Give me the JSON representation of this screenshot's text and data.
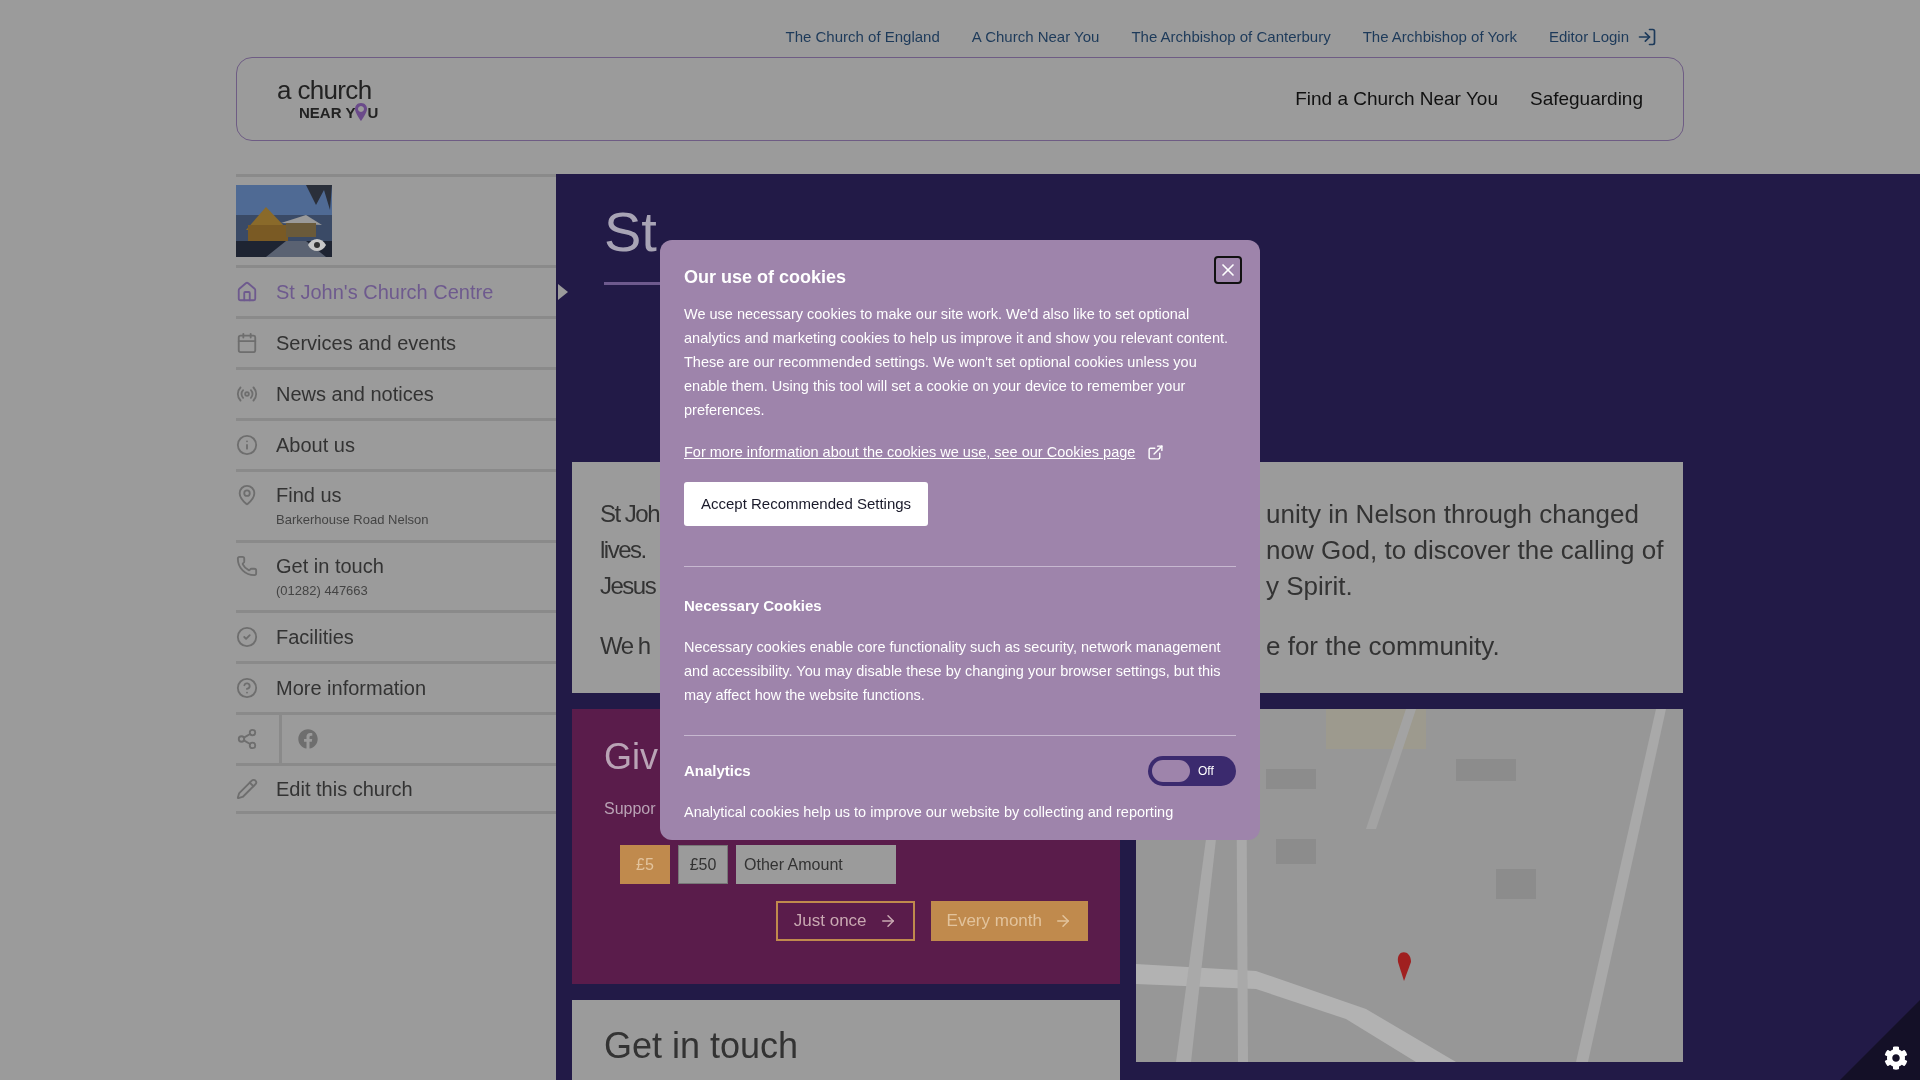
{
  "top_links": [
    {
      "label": "The Church of England"
    },
    {
      "label": "A Church Near You"
    },
    {
      "label": "The Archbishop of Canterbury"
    },
    {
      "label": "The Archbishop of York"
    },
    {
      "label": "Editor Login"
    }
  ],
  "logo": {
    "top": "a church",
    "bottom_left": "NEAR Y",
    "bottom_right": "U"
  },
  "header_nav": [
    "Find a Church Near You",
    "Safeguarding"
  ],
  "sidebar": {
    "items": [
      {
        "kind": "link",
        "label": "St John's Church Centre",
        "selected": true
      },
      {
        "kind": "link",
        "label": "Services and events",
        "selected": false
      },
      {
        "kind": "link",
        "label": "News and notices",
        "selected": false
      },
      {
        "kind": "link",
        "label": "About us",
        "selected": false
      },
      {
        "kind": "link",
        "label": "Find us",
        "sub": "Barkerhouse Road Nelson",
        "selected": false
      },
      {
        "kind": "link",
        "label": "Get in touch",
        "sub": "(01282) 447663",
        "selected": false
      },
      {
        "kind": "link",
        "label": "Facilities",
        "selected": false
      },
      {
        "kind": "link",
        "label": "More information",
        "selected": false
      },
      {
        "kind": "share"
      },
      {
        "kind": "link",
        "label": "Edit this church",
        "selected": false
      }
    ]
  },
  "hero": {
    "title": "St"
  },
  "intro": {
    "left": [
      "St Joh",
      "lives.",
      "Jesus"
    ],
    "right": [
      "unity in Nelson through changed",
      "now God, to discover the calling of",
      "y Spirit."
    ],
    "left2": "We h",
    "right2": "e for the community."
  },
  "give": {
    "title": "Giv",
    "subtitle": "Suppor",
    "amounts": [
      {
        "label": "£5",
        "selected": true
      },
      {
        "label": "£50",
        "selected": false
      }
    ],
    "other_placeholder": "Other Amount",
    "buttons": [
      {
        "label": "Just once",
        "kind": "outline"
      },
      {
        "label": "Every month",
        "kind": "filled"
      }
    ]
  },
  "contact": {
    "title": "Get in touch"
  },
  "cookies": {
    "title": "Our use of cookies",
    "body": "We use necessary cookies to make our site work. We'd also like to set optional analytics and marketing cookies to help us improve it and show you relevant content. These are our recommended settings. We won't set optional cookies unless you enable them. Using this tool will set a cookie on your device to remember your preferences.",
    "link": "For more information about the cookies we use, see our Cookies page",
    "accept": "Accept Recommended Settings",
    "sections": [
      {
        "title": "Necessary Cookies",
        "text": "Necessary cookies enable core functionality such as security, network management and accessibility. You may disable these by changing your browser settings, but this may affect how the website functions."
      },
      {
        "title": "Analytics",
        "toggle": {
          "on": false,
          "label": "Off"
        },
        "text": "Analytical cookies help us to improve our website by collecting and reporting"
      }
    ]
  }
}
